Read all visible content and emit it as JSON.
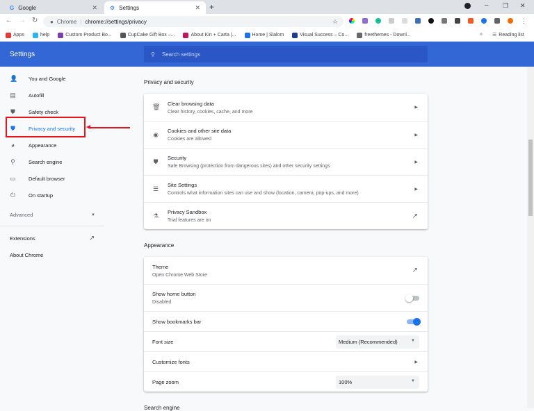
{
  "browser": {
    "tabs": [
      {
        "label": "Google",
        "active": false
      },
      {
        "label": "Settings",
        "active": true
      }
    ],
    "omnibox": {
      "prefix": "Chrome",
      "url": "chrome://settings/privacy"
    },
    "bookmarks": [
      "Apps",
      "help",
      "Custom Product Bo...",
      "CupCake Gift Box –...",
      "About Kin + Carta |...",
      "Home | Slalom",
      "Visual Success – Co...",
      "freethemes - Downl..."
    ],
    "reading_list": "Reading list"
  },
  "header": {
    "title": "Settings",
    "search_placeholder": "Search settings"
  },
  "sidebar": {
    "items": [
      {
        "label": "You and Google",
        "icon": "person-icon"
      },
      {
        "label": "Autofill",
        "icon": "clipboard-icon"
      },
      {
        "label": "Safety check",
        "icon": "shield-check-icon"
      },
      {
        "label": "Privacy and security",
        "icon": "shield-icon",
        "selected": true
      },
      {
        "label": "Appearance",
        "icon": "palette-icon"
      },
      {
        "label": "Search engine",
        "icon": "search-icon"
      },
      {
        "label": "Default browser",
        "icon": "browser-icon"
      },
      {
        "label": "On startup",
        "icon": "power-icon"
      }
    ],
    "advanced": "Advanced",
    "extensions": "Extensions",
    "about": "About Chrome"
  },
  "privacy": {
    "heading": "Privacy and security",
    "rows": [
      {
        "title": "Clear browsing data",
        "subtitle": "Clear history, cookies, cache, and more"
      },
      {
        "title": "Cookies and other site data",
        "subtitle": "Cookies are allowed"
      },
      {
        "title": "Security",
        "subtitle": "Safe Browsing (protection from dangerous sites) and other security settings"
      },
      {
        "title": "Site Settings",
        "subtitle": "Controls what information sites can use and show (location, camera, pop-ups, and more)"
      },
      {
        "title": "Privacy Sandbox",
        "subtitle": "Trial features are on"
      }
    ]
  },
  "appearance": {
    "heading": "Appearance",
    "theme": {
      "title": "Theme",
      "subtitle": "Open Chrome Web Store"
    },
    "home_button": {
      "title": "Show home button",
      "subtitle": "Disabled",
      "on": false
    },
    "bookmarks_bar": {
      "title": "Show bookmarks bar",
      "on": true
    },
    "font_size": {
      "title": "Font size",
      "value": "Medium (Recommended)"
    },
    "customize_fonts": {
      "title": "Customize fonts"
    },
    "page_zoom": {
      "title": "Page zoom",
      "value": "100%"
    }
  },
  "next_heading": "Search engine",
  "colors": {
    "accent": "#1a73e8",
    "header": "#3367d6",
    "highlight": "#e8131b"
  }
}
